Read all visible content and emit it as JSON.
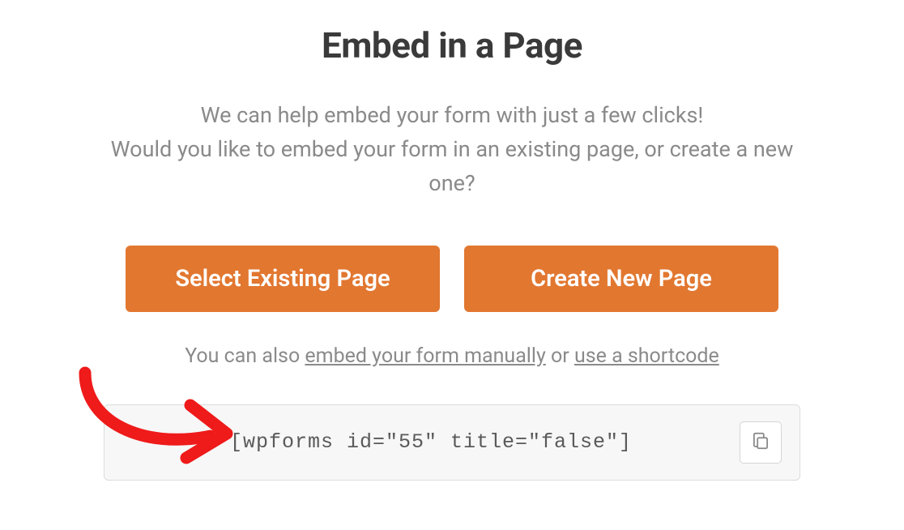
{
  "header": {
    "title": "Embed in a Page",
    "subtitle_line1": "We can help embed your form with just a few clicks!",
    "subtitle_line2": "Would you like to embed your form in an existing page, or create a new one?"
  },
  "buttons": {
    "select_existing_label": "Select Existing Page",
    "create_new_label": "Create New Page"
  },
  "helper": {
    "prefix": "You can also ",
    "link_manual": "embed your form manually",
    "middle": " or ",
    "link_shortcode": "use a shortcode"
  },
  "shortcode": {
    "value": "[wpforms id=\"55\" title=\"false\"]"
  },
  "colors": {
    "accent": "#e27730"
  }
}
